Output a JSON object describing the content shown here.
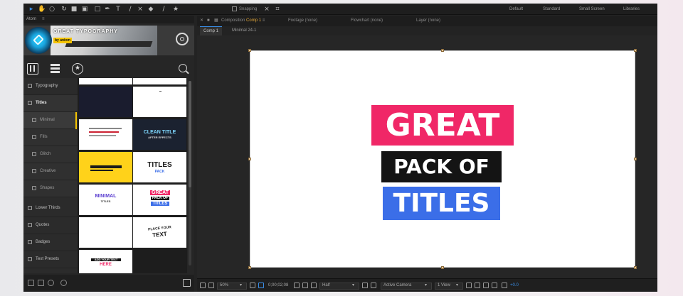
{
  "workspaces": [
    "Default",
    "Standard",
    "Small Screen",
    "Libraries"
  ],
  "toolbar": {
    "snapping_label": "Snapping"
  },
  "atom": {
    "panel_title": "Atom",
    "banner_title": "GREAT TYPOGRAPHY",
    "banner_byline": "by aniom"
  },
  "categories": [
    {
      "label": "Typography"
    },
    {
      "label": "Titles"
    },
    {
      "label": "Minimal"
    },
    {
      "label": "Fills"
    },
    {
      "label": "Glitch"
    },
    {
      "label": "Creative"
    },
    {
      "label": "Shapes"
    },
    {
      "label": "Lower Thirds"
    },
    {
      "label": "Quotes"
    },
    {
      "label": "Badges"
    },
    {
      "label": "Text Presets"
    }
  ],
  "thumbs": {
    "t1_text": "CLEAN TITLE",
    "t1_sub": "AFTER EFFECTS",
    "t2_text": "TITLES",
    "t2_sub": "PACK",
    "t3_text": "MINIMAL",
    "t3_sub": "TITLES",
    "t4_l1": "GREAT",
    "t4_l2": "PACK OF",
    "t4_l3": "TITLES",
    "t5_l1": "PLACE YOUR",
    "t5_l2": "TEXT",
    "t6_l1": "ADD YOUR TEXT",
    "t6_l2": "HERE"
  },
  "panels": {
    "composition_prefix": "Composition",
    "composition_name": "Comp 1",
    "footage": "Footage (none)",
    "flowchart": "Flowchart (none)",
    "layer": "Layer (none)"
  },
  "comp_tabs": [
    "Comp 1",
    "Minimal 24-1"
  ],
  "canvas": {
    "line1": "GREAT",
    "line2": "PACK OF",
    "line3": "TITLES"
  },
  "viewer_bar": {
    "zoom": "50%",
    "timecode": "0;00;02;08",
    "resolution": "Half",
    "camera": "Active Camera",
    "views": "1 View",
    "exposure": "+0.0"
  },
  "colors": {
    "accent_pink": "#f02767",
    "accent_black": "#141414",
    "accent_blue": "#3b6ee8",
    "selection_blue": "#3a8ee8",
    "atom_yellow": "#f5c400"
  }
}
